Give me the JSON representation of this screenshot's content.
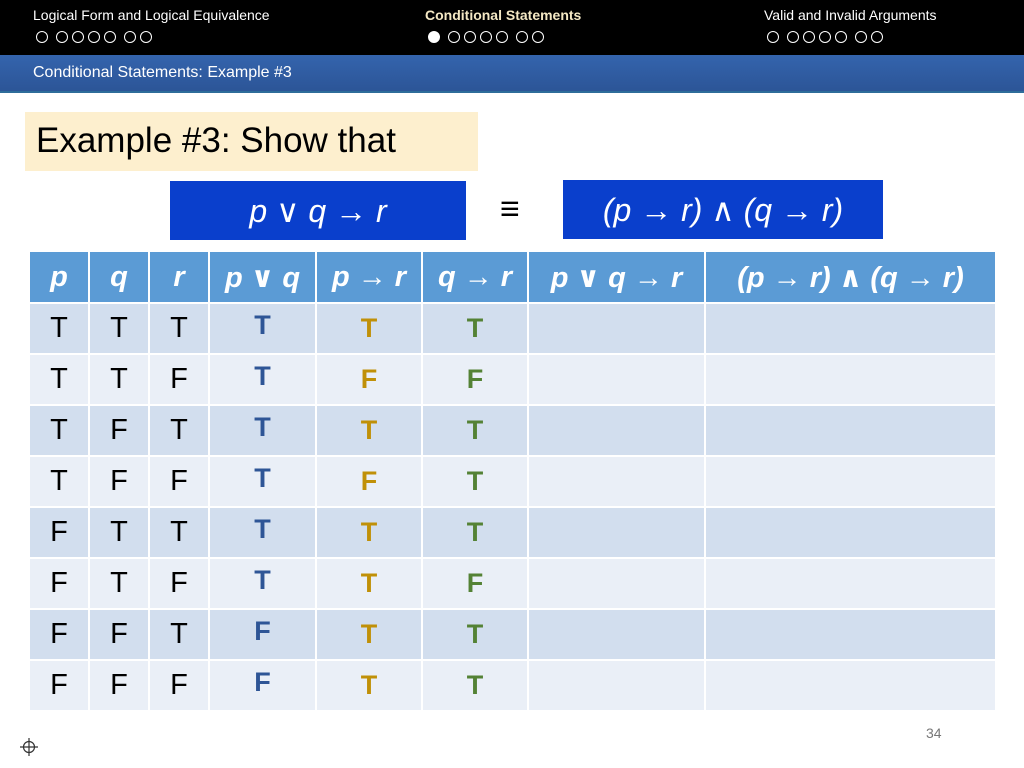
{
  "nav": {
    "sections": [
      {
        "label": "Logical Form and Logical Equivalence",
        "dots": 7,
        "filled": -1,
        "active": false
      },
      {
        "label": "Conditional Statements",
        "dots": 7,
        "filled": 0,
        "active": true
      },
      {
        "label": "Valid and Invalid Arguments",
        "dots": 7,
        "filled": -1,
        "active": false
      }
    ]
  },
  "slide_title": "Conditional Statements: Example #3",
  "example": {
    "heading": "Example #3: Show that",
    "left_formula": "p ∨ q → r",
    "equiv_symbol": "≡",
    "right_formula": "(p → r) ∧ (q → r)"
  },
  "table": {
    "headers": [
      "p",
      "q",
      "r",
      "p ∨ q",
      "p → r",
      "q → r",
      "p ∨ q → r",
      "(p → r) ∧ (q → r)"
    ],
    "rows": [
      [
        "T",
        "T",
        "T",
        "T",
        "T",
        "T",
        "",
        ""
      ],
      [
        "T",
        "T",
        "F",
        "T",
        "F",
        "F",
        "",
        ""
      ],
      [
        "T",
        "F",
        "T",
        "T",
        "T",
        "T",
        "",
        ""
      ],
      [
        "T",
        "F",
        "F",
        "T",
        "F",
        "T",
        "",
        ""
      ],
      [
        "F",
        "T",
        "T",
        "T",
        "T",
        "T",
        "",
        ""
      ],
      [
        "F",
        "T",
        "F",
        "T",
        "T",
        "F",
        "",
        ""
      ],
      [
        "F",
        "F",
        "T",
        "F",
        "T",
        "T",
        "",
        ""
      ],
      [
        "F",
        "F",
        "F",
        "F",
        "T",
        "T",
        "",
        ""
      ]
    ]
  },
  "colors": {
    "header_bg": "#5b9bd5",
    "p_or_q": "#2e5596",
    "p_implies_r": "#c09008",
    "q_implies_r": "#548235",
    "formula_bg": "#0a3fcc",
    "example_bg": "#fdefce"
  },
  "page_number": "34",
  "icons": {
    "crosshair": "crosshair-icon"
  }
}
